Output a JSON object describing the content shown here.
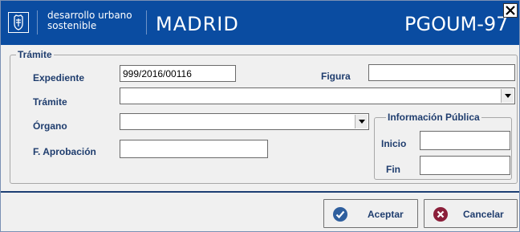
{
  "header": {
    "brand_line1": "desarrollo urbano",
    "brand_line2": "sostenible",
    "city": "MADRID",
    "plan": "PGOUM-97",
    "colors": {
      "bar": "#0a4ca1",
      "text": "#ffffff"
    },
    "logo_icon": "madrid-crest-icon",
    "close_icon": "close-icon"
  },
  "form": {
    "group_legend": "Trámite",
    "expediente": {
      "label": "Expediente",
      "value": "999/2016/00116"
    },
    "figura": {
      "label": "Figura",
      "value": ""
    },
    "tramite": {
      "label": "Trámite",
      "value": ""
    },
    "organo": {
      "label": "Órgano",
      "value": ""
    },
    "aprobacion": {
      "label": "F. Aprobación",
      "value": ""
    },
    "info_publica": {
      "legend": "Información Pública",
      "inicio": {
        "label": "Inicio",
        "value": ""
      },
      "fin": {
        "label": "Fin",
        "value": ""
      }
    }
  },
  "buttons": {
    "accept": {
      "label": "Aceptar",
      "icon": "check-circle-icon",
      "color": "#2f5f9e"
    },
    "cancel": {
      "label": "Cancelar",
      "icon": "x-circle-icon",
      "color": "#8b1f3a"
    }
  }
}
